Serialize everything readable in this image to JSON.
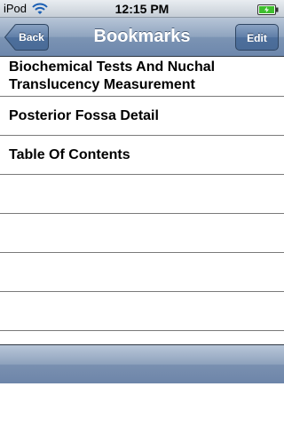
{
  "status_bar": {
    "carrier": "iPod",
    "time": "12:15 PM",
    "wifi_icon": "wifi-icon",
    "battery_icon": "battery-charging-icon",
    "battery_color": "#3fbf2f"
  },
  "nav_bar": {
    "title": "Bookmarks",
    "back_label": "Back",
    "edit_label": "Edit",
    "tint": "#6d87ac"
  },
  "bookmarks": [
    {
      "label": "Biochemical Tests And Nuchal Translucency Measurement"
    },
    {
      "label": "Posterior Fossa Detail"
    },
    {
      "label": "Table Of Contents"
    }
  ]
}
